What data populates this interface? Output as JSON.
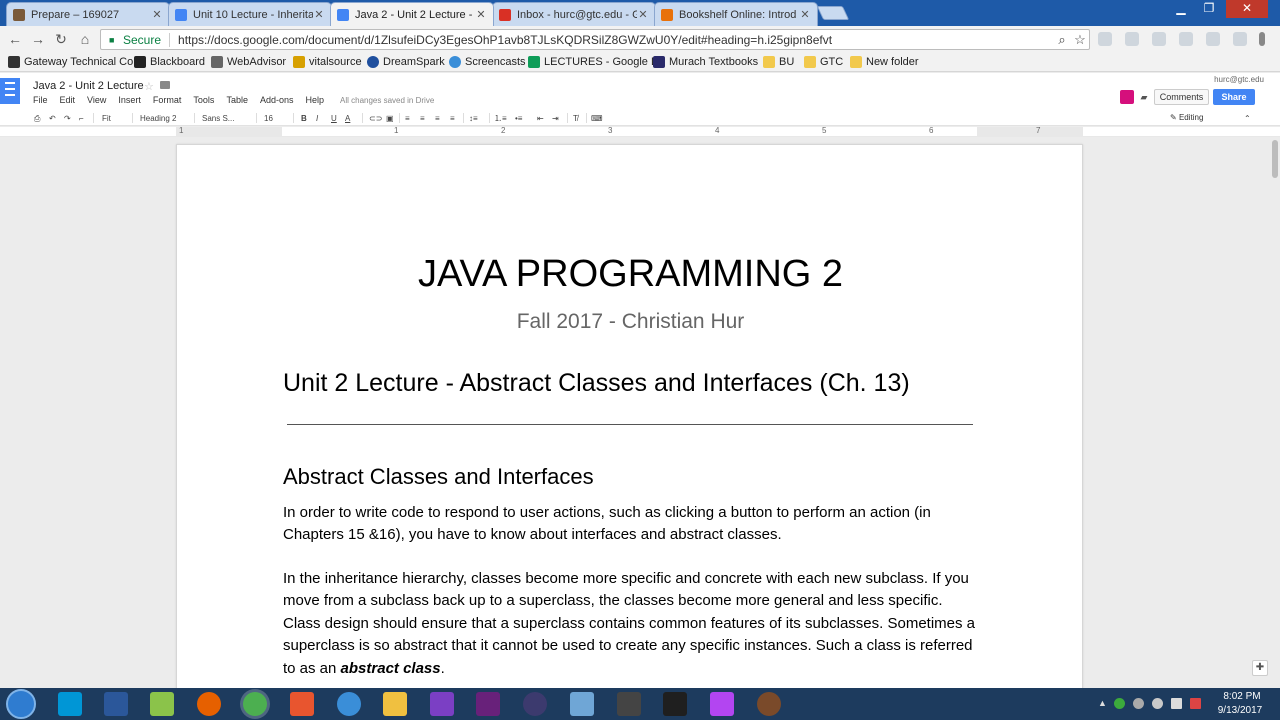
{
  "browser": {
    "tabs": [
      {
        "label": "Prepare – 169027",
        "icon": "prepare-favicon",
        "color": "#7a5a3a"
      },
      {
        "label": "Unit 10 Lecture - Inherita",
        "icon": "docs-favicon",
        "color": "#4285f4"
      },
      {
        "label": "Java 2 - Unit 2 Lecture - G",
        "icon": "docs-favicon",
        "color": "#4285f4"
      },
      {
        "label": "Inbox - hurc@gtc.edu - G",
        "icon": "gmail-favicon",
        "color": "#d93025"
      },
      {
        "label": "Bookshelf Online: Introd",
        "icon": "bookshelf-favicon",
        "color": "#e8710a"
      }
    ],
    "secure_label": "Secure",
    "url": "https://docs.google.com/document/d/1ZlsufeiDCy3EgesOhP1avb8TJLsKQDRSilZ8GWZwU0Y/edit#heading=h.i25gipn8efvt",
    "bookmarks": [
      {
        "label": "Gateway Technical Co",
        "icon": "gateway-icon",
        "color": "#333"
      },
      {
        "label": "Blackboard",
        "icon": "blackboard-icon",
        "color": "#222"
      },
      {
        "label": "WebAdvisor",
        "icon": "webadvisor-icon",
        "color": "#666"
      },
      {
        "label": "vitalsource",
        "icon": "vitalsource-icon",
        "color": "#d7a000"
      },
      {
        "label": "DreamSpark",
        "icon": "dreamspark-icon",
        "color": "#1f4f9e"
      },
      {
        "label": "Screencasts",
        "icon": "screencasts-icon",
        "color": "#3a8ed8"
      },
      {
        "label": "LECTURES - Google D",
        "icon": "drive-icon",
        "color": "#0f9d58"
      },
      {
        "label": "Murach Textbooks",
        "icon": "murach-icon",
        "color": "#2a2a6a"
      },
      {
        "label": "BU",
        "icon": "folder-icon",
        "color": "#f2c94c"
      },
      {
        "label": "GTC",
        "icon": "folder-icon",
        "color": "#f2c94c"
      },
      {
        "label": "New folder",
        "icon": "folder-icon",
        "color": "#f2c94c"
      }
    ]
  },
  "docs": {
    "title": "Java 2 - Unit 2 Lecture",
    "menus": [
      "File",
      "Edit",
      "View",
      "Insert",
      "Format",
      "Tools",
      "Table",
      "Add-ons",
      "Help"
    ],
    "save_status": "All changes saved in Drive",
    "account": "hurc@gtc.edu",
    "comments_label": "Comments",
    "share_label": "Share",
    "toolbar": {
      "zoom": "Fit",
      "style": "Heading 2",
      "font": "Sans S...",
      "size": "16",
      "mode": "Editing"
    },
    "ruler_marks": [
      "1",
      "1",
      "2",
      "3",
      "4",
      "5",
      "6",
      "7"
    ]
  },
  "document": {
    "heading": "JAVA PROGRAMMING 2",
    "subtitle": "Fall 2017 - Christian Hur",
    "unit_heading": "Unit 2 Lecture - Abstract Classes and Interfaces (Ch. 13)",
    "section_heading": "Abstract Classes and Interfaces",
    "para1": "In order to write code to respond to user actions, such as clicking a button to perform an action (in Chapters 15 &16), you have to know about interfaces and abstract classes.",
    "para2_text": "In the inheritance hierarchy, classes become more specific and concrete with each new subclass.  If you move from a subclass back up to a superclass, the classes become more general and less specific. Class design should ensure that a superclass contains common features of its subclasses. Sometimes a superclass is so abstract that it cannot be used to create any specific instances. Such a class is referred to as an ",
    "para2_emphasis": "abstract class",
    "para2_end": "."
  },
  "taskbar": {
    "apps": [
      {
        "name": "hp-support-icon",
        "color": "#0096d6"
      },
      {
        "name": "word-icon",
        "color": "#2b579a"
      },
      {
        "name": "remote-desktop-icon",
        "color": "#8bc34a"
      },
      {
        "name": "firefox-icon",
        "color": "#e66000"
      },
      {
        "name": "chrome-icon",
        "color": "#4caf50"
      },
      {
        "name": "camtasia-icon",
        "color": "#e8552f"
      },
      {
        "name": "screencast-o-matic-icon",
        "color": "#3a8ed8"
      },
      {
        "name": "file-explorer-icon",
        "color": "#f0c040"
      },
      {
        "name": "visual-studio-icon",
        "color": "#7b3fc4"
      },
      {
        "name": "visual-studio-2-icon",
        "color": "#68217a"
      },
      {
        "name": "eclipse-icon",
        "color": "#3c3a6e"
      },
      {
        "name": "virtualbox-icon",
        "color": "#6fa6d6"
      },
      {
        "name": "g-app-icon",
        "color": "#444"
      },
      {
        "name": "webstorm-icon",
        "color": "#1f1f1f"
      },
      {
        "name": "phpstorm-icon",
        "color": "#b345f1"
      },
      {
        "name": "tomcat-icon",
        "color": "#7a4a2a"
      }
    ],
    "time": "8:02 PM",
    "date": "9/13/2017"
  }
}
